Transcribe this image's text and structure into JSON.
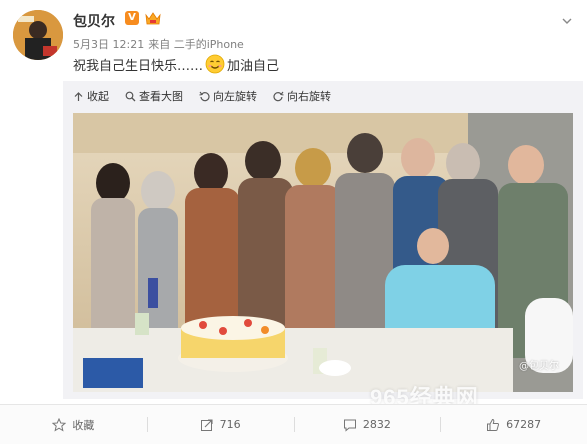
{
  "user": {
    "name": "包贝尔",
    "verified_label": "V"
  },
  "post": {
    "time": "5月3日 12:21",
    "source": "来自 二手的iPhone",
    "text_before": "祝我自己生日快乐……",
    "text_after": "加油自己",
    "emoji": "smile-emoji"
  },
  "media_toolbar": {
    "collapse": "收起",
    "view_large": "查看大图",
    "rotate_left": "向左旋转",
    "rotate_right": "向右旋转"
  },
  "photo": {
    "watermark": "@包贝尔"
  },
  "footer": {
    "favorite": "收藏",
    "repost_count": "716",
    "comment_count": "2832",
    "like_count": "67287"
  },
  "site_watermark": "965经典网",
  "colors": {
    "accent_orange": "#f78c1f",
    "meta_gray": "#808080",
    "media_bg": "#f2f2f5"
  }
}
